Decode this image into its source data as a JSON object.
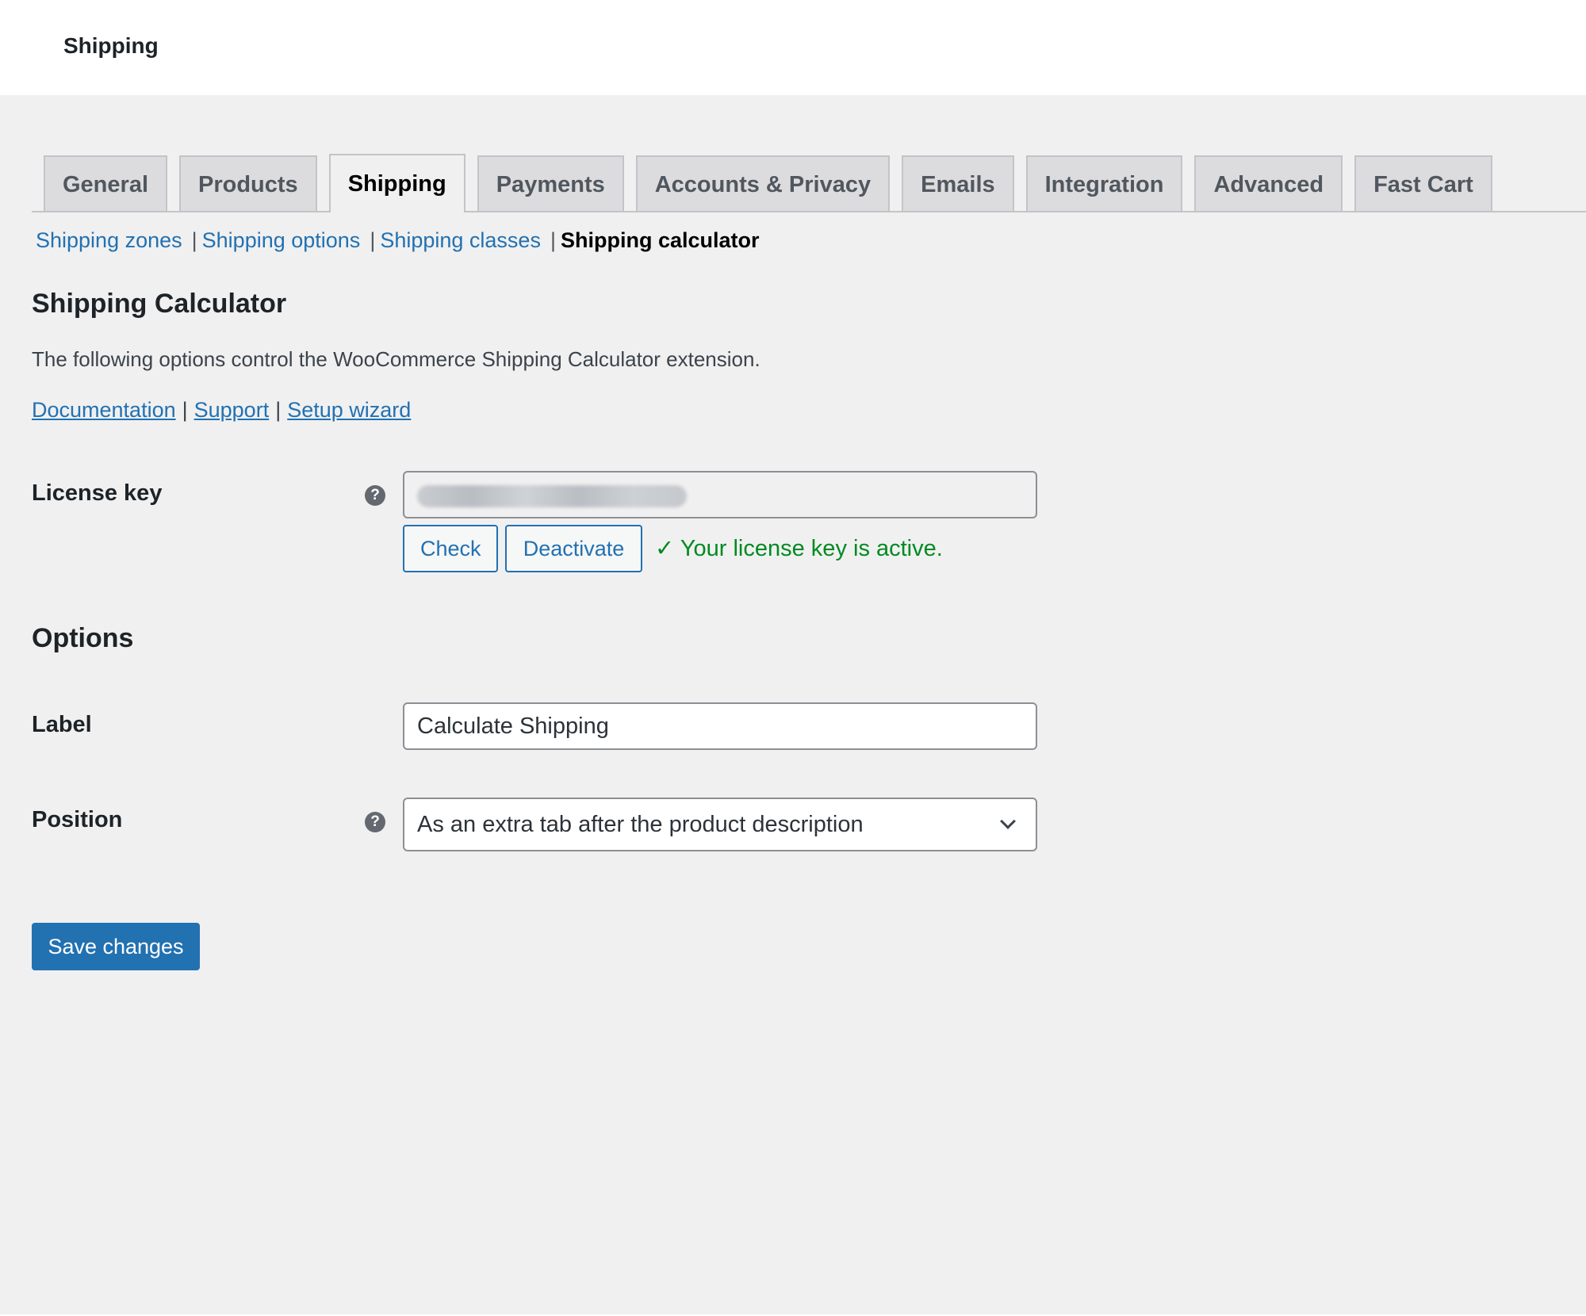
{
  "header": {
    "title": "Shipping"
  },
  "tabs": [
    {
      "label": "General",
      "active": false
    },
    {
      "label": "Products",
      "active": false
    },
    {
      "label": "Shipping",
      "active": true
    },
    {
      "label": "Payments",
      "active": false
    },
    {
      "label": "Accounts & Privacy",
      "active": false
    },
    {
      "label": "Emails",
      "active": false
    },
    {
      "label": "Integration",
      "active": false
    },
    {
      "label": "Advanced",
      "active": false
    },
    {
      "label": "Fast Cart",
      "active": false
    }
  ],
  "subnav": {
    "items": [
      "Shipping zones",
      "Shipping options",
      "Shipping classes"
    ],
    "separator": "|",
    "current": "Shipping calculator"
  },
  "section": {
    "title": "Shipping Calculator",
    "description": "The following options control the WooCommerce Shipping Calculator extension.",
    "links": [
      "Documentation",
      "Support",
      "Setup wizard"
    ],
    "link_separator": "|"
  },
  "license": {
    "label": "License key",
    "help_icon": "question-circle-icon",
    "help_glyph": "?",
    "check_label": "Check",
    "deactivate_label": "Deactivate",
    "status_text": "✓ Your license key is active.",
    "status_color": "#008a20"
  },
  "options": {
    "title": "Options",
    "label_field": {
      "label": "Label",
      "value": "Calculate Shipping"
    },
    "position_field": {
      "label": "Position",
      "help_glyph": "?",
      "selected": "As an extra tab after the product description"
    }
  },
  "save_label": "Save changes",
  "colors": {
    "accent": "#2271b1",
    "background": "#f0f0f1",
    "success": "#008a20"
  }
}
